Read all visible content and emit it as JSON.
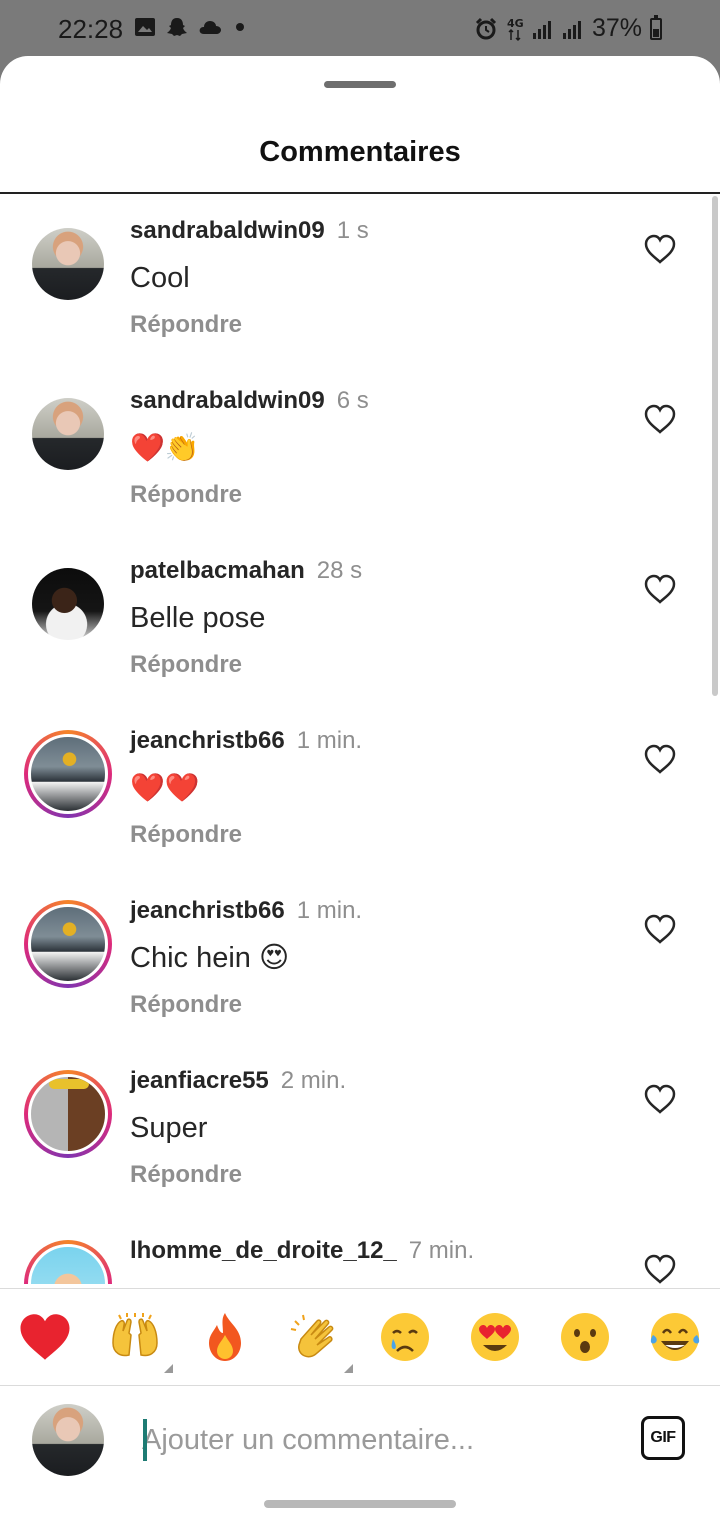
{
  "status_bar": {
    "time": "22:28",
    "battery": "37%",
    "left_icons": [
      "gallery-icon",
      "snapchat-icon",
      "cloud-icon",
      "dot-icon"
    ],
    "right_icons": [
      "alarm-icon",
      "4g-icon",
      "signal-icon",
      "signal-icon",
      "battery-icon"
    ]
  },
  "sheet": {
    "title": "Commentaires"
  },
  "comments": [
    {
      "user": "sandrabaldwin09",
      "time": "1 s",
      "text": "Cool",
      "reply": "Répondre",
      "avatar": "sandra",
      "story": false
    },
    {
      "user": "sandrabaldwin09",
      "time": "6 s",
      "text": "❤️👏",
      "reply": "Répondre",
      "avatar": "sandra",
      "story": false
    },
    {
      "user": "patelbacmahan",
      "time": "28 s",
      "text": "Belle pose",
      "reply": "Répondre",
      "avatar": "patel",
      "story": false
    },
    {
      "user": "jeanchristb66",
      "time": "1 min.",
      "text": "❤️❤️",
      "reply": "Répondre",
      "avatar": "jean",
      "story": true
    },
    {
      "user": "jeanchristb66",
      "time": "1 min.",
      "text": "Chic hein 😍",
      "reply": "Répondre",
      "avatar": "jean",
      "story": true
    },
    {
      "user": "jeanfiacre55",
      "time": "2 min.",
      "text": "Super",
      "reply": "Répondre",
      "avatar": "fiacre",
      "story": true
    },
    {
      "user": "lhomme_de_droite_12_",
      "time": "7 min.",
      "text": "",
      "reply": "",
      "avatar": "lhomme",
      "story": true
    }
  ],
  "reactions": [
    "❤️",
    "🙌",
    "🔥",
    "👏",
    "😢",
    "😍",
    "😮",
    "😂"
  ],
  "composer": {
    "placeholder": "Ajouter un commentaire...",
    "gif_label": "GIF"
  }
}
